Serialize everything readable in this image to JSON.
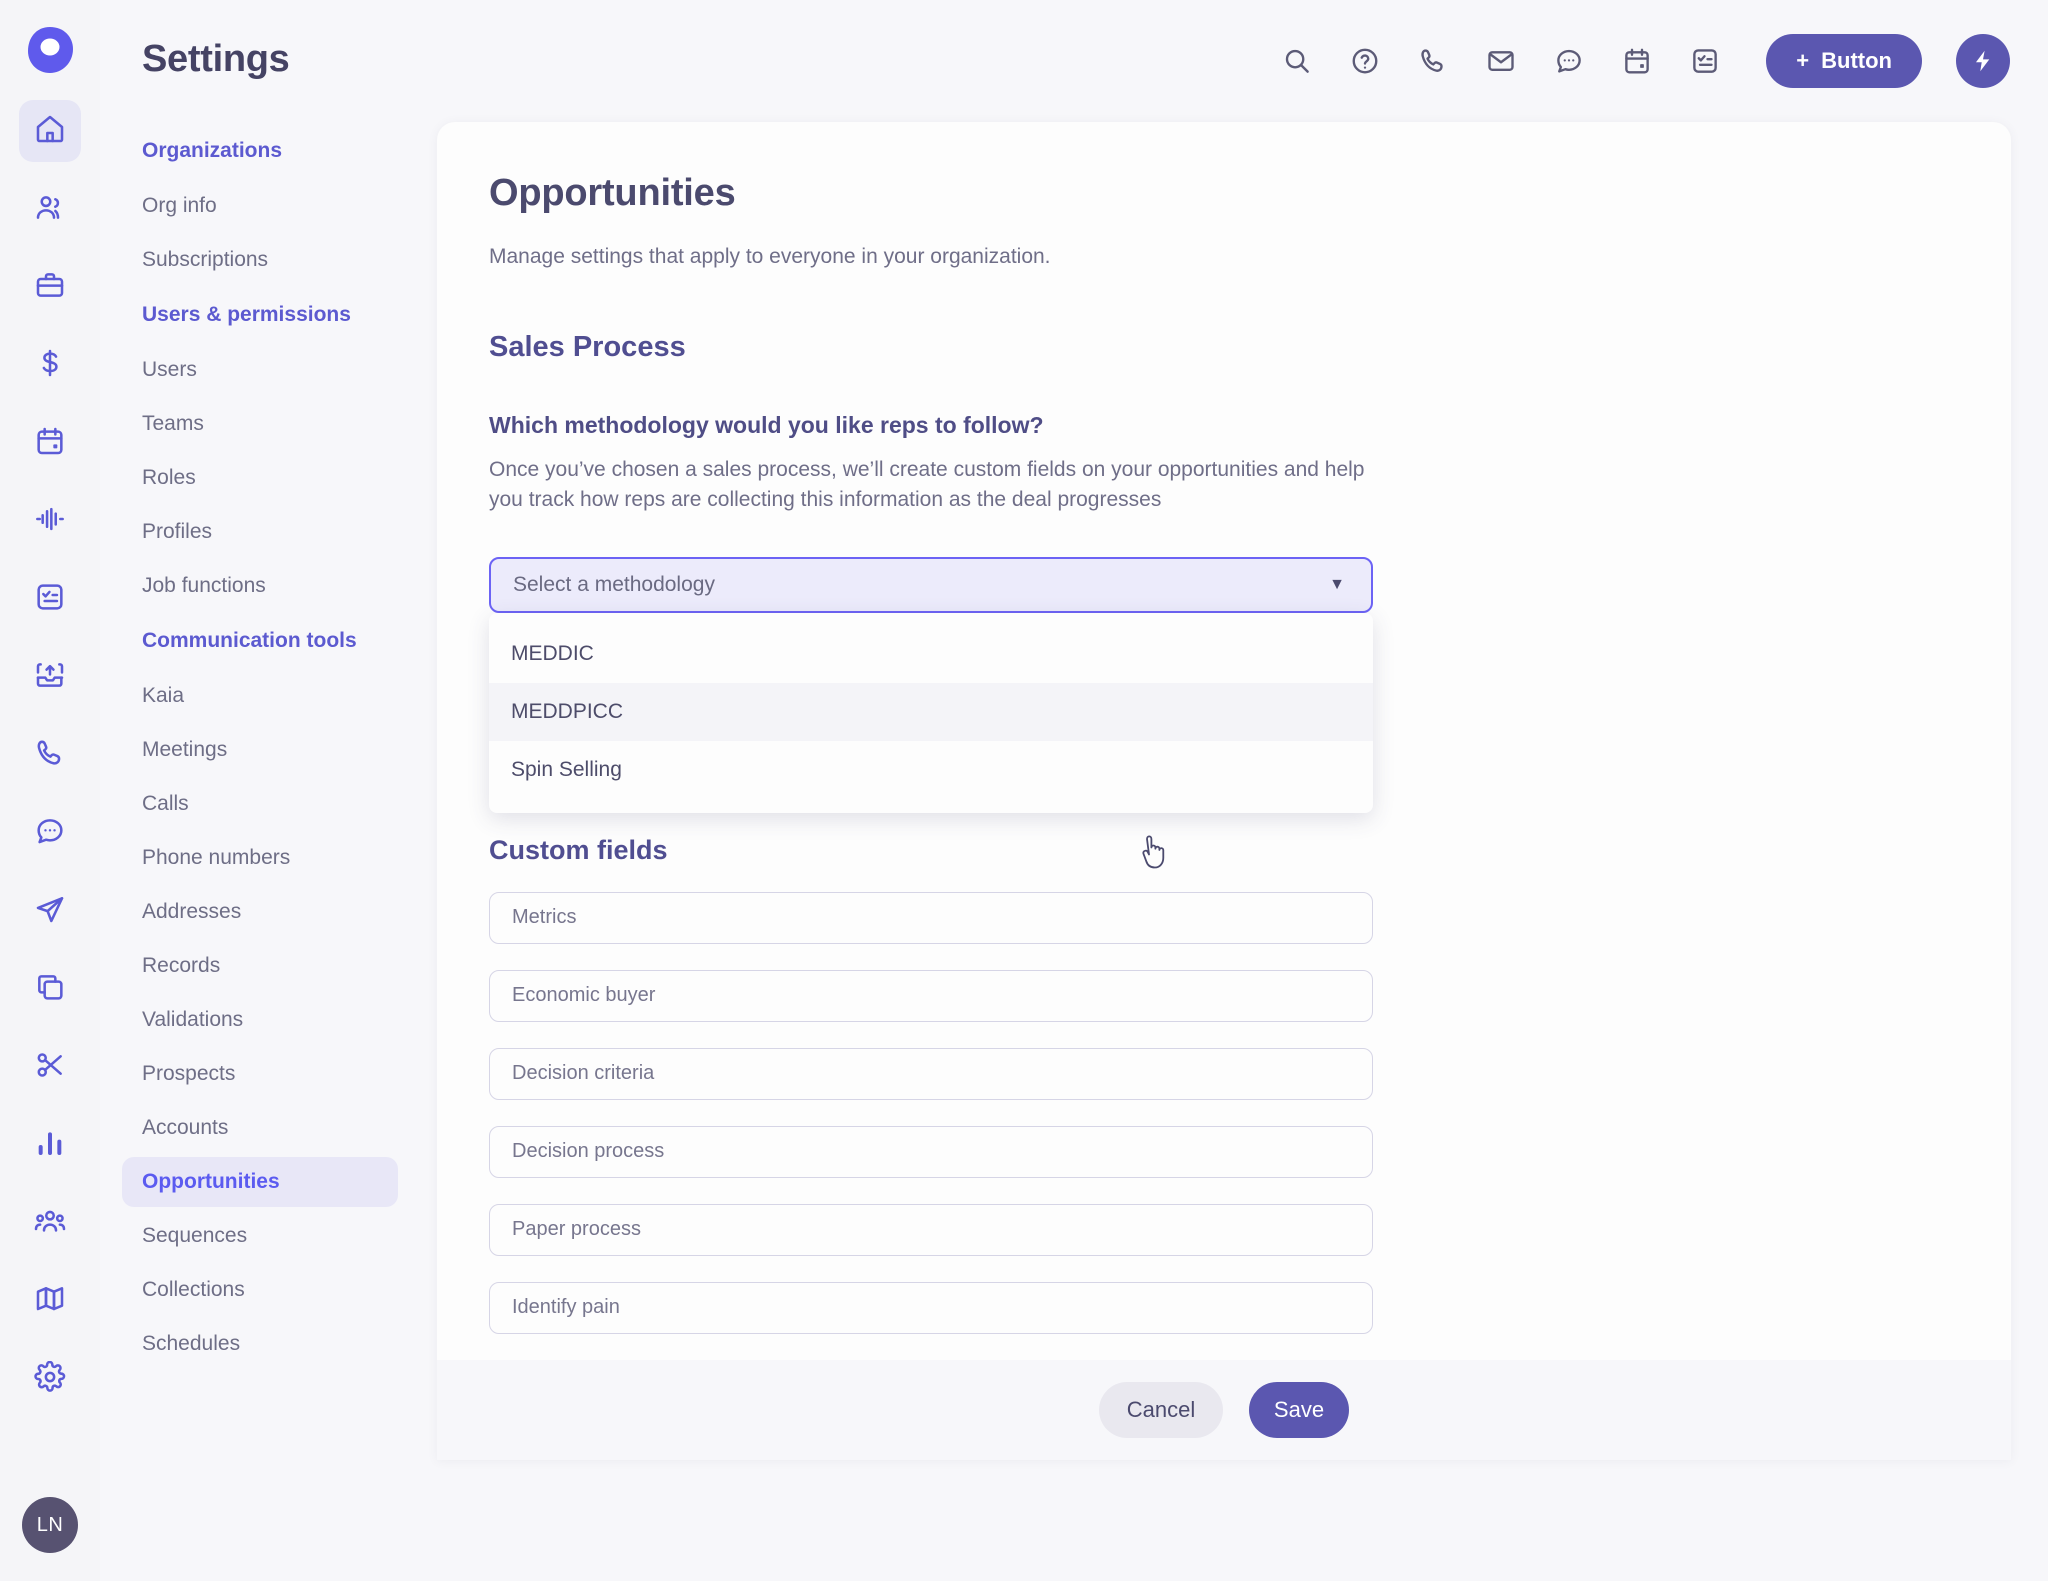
{
  "brand": {
    "logo_name": "app-logo",
    "accent": "#5b57b0",
    "accent_bright": "#6c63f5",
    "heading_color": "#4b4a6e"
  },
  "rail": {
    "items": [
      {
        "icon": "home-icon",
        "active": true
      },
      {
        "icon": "people-icon",
        "active": false
      },
      {
        "icon": "briefcase-icon",
        "active": false
      },
      {
        "icon": "dollar-icon",
        "active": false
      },
      {
        "icon": "calendar-icon",
        "active": false
      },
      {
        "icon": "waveform-icon",
        "active": false
      },
      {
        "icon": "checklist-icon",
        "active": false
      },
      {
        "icon": "upload-box-icon",
        "active": false
      },
      {
        "icon": "phone-icon",
        "active": false
      },
      {
        "icon": "chat-icon",
        "active": false
      },
      {
        "icon": "send-icon",
        "active": false
      },
      {
        "icon": "copy-icon",
        "active": false
      },
      {
        "icon": "scissors-icon",
        "active": false
      },
      {
        "icon": "bar-chart-icon",
        "active": false
      },
      {
        "icon": "group-icon",
        "active": false
      },
      {
        "icon": "map-icon",
        "active": false
      },
      {
        "icon": "gear-icon",
        "active": false
      }
    ],
    "avatar_initials": "LN"
  },
  "settings": {
    "title": "Settings",
    "nav": [
      {
        "type": "header",
        "label": "Organizations"
      },
      {
        "type": "item",
        "label": "Org info",
        "active": false
      },
      {
        "type": "item",
        "label": "Subscriptions",
        "active": false
      },
      {
        "type": "header",
        "label": "Users & permissions"
      },
      {
        "type": "item",
        "label": "Users",
        "active": false
      },
      {
        "type": "item",
        "label": "Teams",
        "active": false
      },
      {
        "type": "item",
        "label": "Roles",
        "active": false
      },
      {
        "type": "item",
        "label": "Profiles",
        "active": false
      },
      {
        "type": "item",
        "label": "Job functions",
        "active": false
      },
      {
        "type": "header",
        "label": "Communication tools"
      },
      {
        "type": "item",
        "label": "Kaia",
        "active": false
      },
      {
        "type": "item",
        "label": "Meetings",
        "active": false
      },
      {
        "type": "item",
        "label": "Calls",
        "active": false
      },
      {
        "type": "item",
        "label": "Phone numbers",
        "active": false
      },
      {
        "type": "item",
        "label": "Addresses",
        "active": false
      },
      {
        "type": "item",
        "label": "Records",
        "active": false
      },
      {
        "type": "item",
        "label": "Validations",
        "active": false
      },
      {
        "type": "item",
        "label": "Prospects",
        "active": false
      },
      {
        "type": "item",
        "label": "Accounts",
        "active": false
      },
      {
        "type": "item",
        "label": "Opportunities",
        "active": true
      },
      {
        "type": "item",
        "label": "Sequences",
        "active": false
      },
      {
        "type": "item",
        "label": "Collections",
        "active": false
      },
      {
        "type": "item",
        "label": "Schedules",
        "active": false
      }
    ]
  },
  "topbar": {
    "icons": [
      "search-icon",
      "help-circle-icon",
      "phone-icon",
      "mail-icon",
      "chat-icon",
      "calendar-icon",
      "task-icon"
    ],
    "primary_button": "Button",
    "primary_button_plus": "+",
    "bolt_icon": "lightning-bolt-icon"
  },
  "main": {
    "page_title": "Opportunities",
    "page_subtitle": "Manage settings that apply to everyone in your organization.",
    "section_title": "Sales Process",
    "question_title": "Which methodology would you like reps to follow?",
    "question_desc": "Once you’ve chosen a sales process, we’ll create custom fields on your opportunities and help you track how reps are collecting this information as the deal progresses",
    "select": {
      "placeholder": "Select a methodology",
      "value": "",
      "caret": "▼",
      "open": true,
      "options": [
        {
          "label": "MEDDIC",
          "hovered": false
        },
        {
          "label": "MEDDPICC",
          "hovered": true
        },
        {
          "label": "Spin Selling",
          "hovered": false
        }
      ]
    },
    "custom_fields_title": "Custom fields",
    "custom_fields": [
      {
        "placeholder": "Metrics",
        "value": ""
      },
      {
        "placeholder": "Economic buyer",
        "value": ""
      },
      {
        "placeholder": "Decision criteria",
        "value": ""
      },
      {
        "placeholder": "Decision process",
        "value": ""
      },
      {
        "placeholder": "Paper process",
        "value": ""
      },
      {
        "placeholder": "Identify pain",
        "value": ""
      }
    ]
  },
  "footer": {
    "cancel_label": "Cancel",
    "save_label": "Save"
  }
}
